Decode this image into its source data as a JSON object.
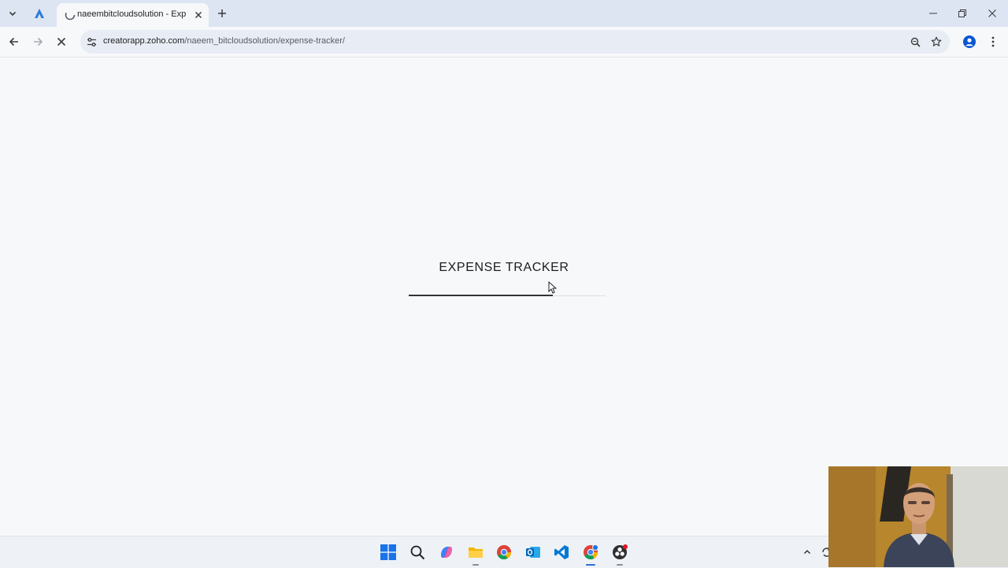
{
  "browser": {
    "tab": {
      "title": "naeembitcloudsolution - Expense Tracker"
    },
    "address_bar": {
      "url_host": "creatorapp.zoho.com",
      "url_path": "/naeem_bitcloudsolution/expense-tracker/"
    },
    "icons": {
      "tab_list": "chevron-down-icon",
      "pinned_tab": "zoho-creator-icon",
      "tab_favicon": "loading-icon",
      "tab_close": "close-icon",
      "new_tab": "plus-icon",
      "back": "arrow-left-icon",
      "forward": "arrow-right-icon",
      "stop": "close-icon",
      "site_info": "tune-icon",
      "zoom": "zoom-icon",
      "bookmark": "star-icon",
      "profile": "person-icon",
      "menu": "more-vertical-icon",
      "minimize": "minimize-icon",
      "restore": "restore-icon",
      "close_window": "close-icon"
    }
  },
  "page": {
    "app_title": "EXPENSE TRACKER",
    "loading_progress": 0.73
  },
  "taskbar": {
    "items": [
      {
        "name": "start",
        "icon": "windows-icon"
      },
      {
        "name": "search",
        "icon": "search-icon"
      },
      {
        "name": "copilot",
        "icon": "copilot-icon"
      },
      {
        "name": "file-explorer",
        "icon": "folder-icon"
      },
      {
        "name": "chrome",
        "icon": "chrome-icon"
      },
      {
        "name": "outlook",
        "icon": "outlook-icon"
      },
      {
        "name": "vscode",
        "icon": "vscode-icon"
      },
      {
        "name": "chrome-active",
        "icon": "chrome-icon"
      },
      {
        "name": "obs",
        "icon": "obs-icon"
      }
    ],
    "tray": {
      "chevron": "chevron-up-icon",
      "sync": "sync-icon"
    }
  },
  "colors": {
    "tabstrip": "#dde5f3",
    "page_background": "#f6f8fa",
    "omnibox": "#e8edf5",
    "accent": "#2f6fd6"
  }
}
